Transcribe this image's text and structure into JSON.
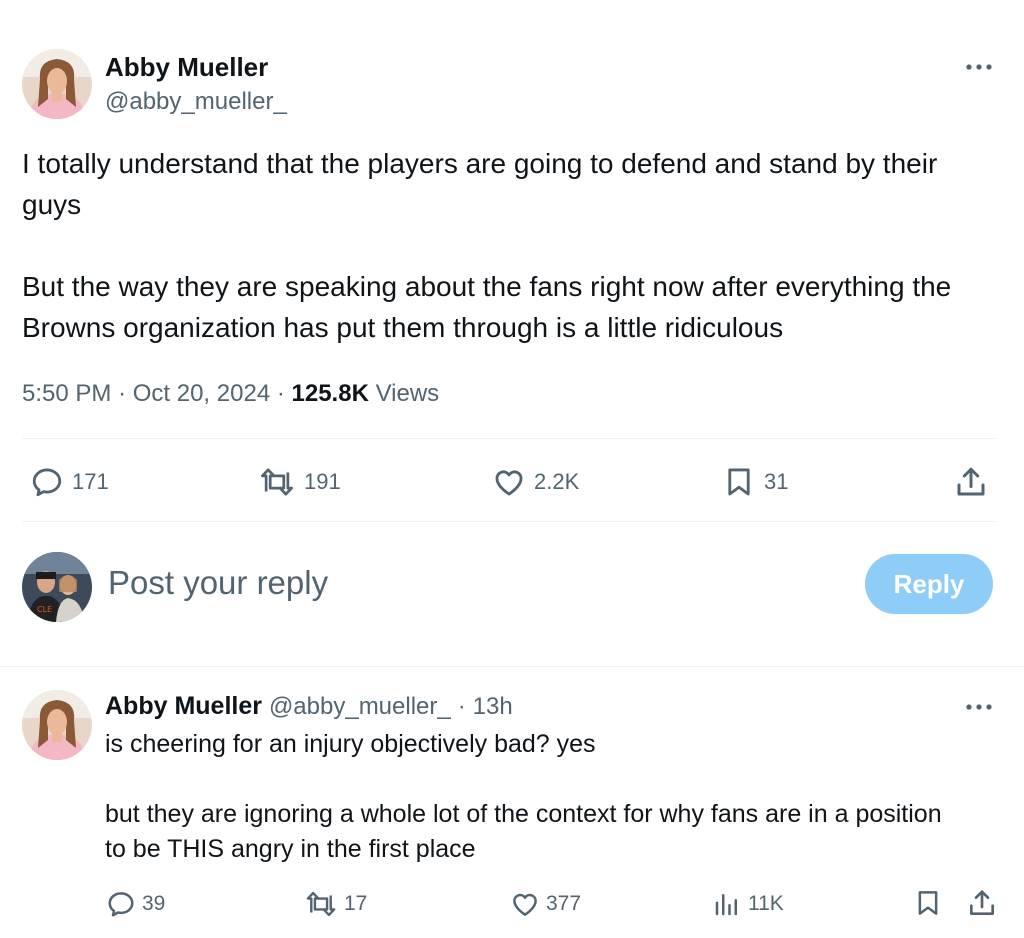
{
  "tweet": {
    "author_name": "Abby Mueller",
    "author_handle": "@abby_mueller_",
    "text": "I totally understand that the players are going to defend and stand by their guys\n\nBut the way they are speaking about the fans right now after everything the Browns organization has put them through is a little ridiculous",
    "time": "5:50 PM",
    "date": "Oct 20, 2024",
    "views_count": "125.8K",
    "views_label": "Views",
    "replies": "171",
    "reposts": "191",
    "likes": "2.2K",
    "bookmarks": "31"
  },
  "composer": {
    "placeholder": "Post your reply",
    "reply_button": "Reply"
  },
  "reply": {
    "author_name": "Abby Mueller",
    "author_handle": "@abby_mueller_",
    "time_ago": "13h",
    "text": "is cheering for an injury objectively bad? yes\n\nbut they are ignoring a whole lot of the context for why fans are in a position to be THIS angry in the first place",
    "replies": "39",
    "reposts": "17",
    "likes": "377",
    "views": "11K"
  },
  "icons": {
    "more": "more-icon",
    "reply": "reply-icon",
    "repost": "repost-icon",
    "like": "heart-icon",
    "bookmark": "bookmark-icon",
    "share": "share-icon",
    "views": "analytics-icon"
  },
  "colors": {
    "text": "#0f1419",
    "secondary": "#536471",
    "reply_button": "#8ecdf8",
    "divider": "#eff3f4"
  }
}
